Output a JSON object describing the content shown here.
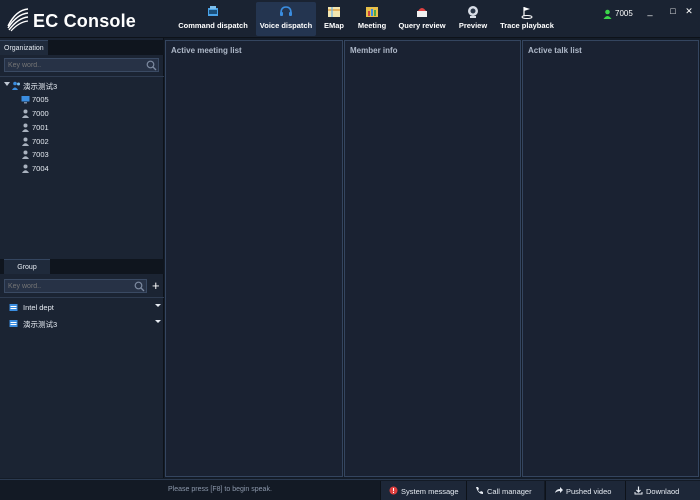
{
  "app": {
    "title": "EC Console"
  },
  "nav": [
    {
      "label": "Command dispatch",
      "icon": "command-dispatch-icon"
    },
    {
      "label": "Voice dispatch",
      "icon": "headset-icon",
      "active": true
    },
    {
      "label": "EMap",
      "icon": "map-icon"
    },
    {
      "label": "Meeting",
      "icon": "meeting-icon"
    },
    {
      "label": "Query review",
      "icon": "query-icon"
    },
    {
      "label": "Preview",
      "icon": "camera-icon"
    },
    {
      "label": "Trace playback",
      "icon": "trace-icon"
    }
  ],
  "user": {
    "name": "7005",
    "status_color": "#3cd64a"
  },
  "window_controls": {
    "minimize": "_",
    "maximize": "□",
    "close": "✕"
  },
  "organization": {
    "tab_label": "Organization",
    "search_placeholder": "Key word..",
    "root": "演示测试3",
    "members": [
      "7005",
      "7000",
      "7001",
      "7002",
      "7003",
      "7004"
    ]
  },
  "group": {
    "tab_label": "Group",
    "search_placeholder": "Key word..",
    "items": [
      "Intel dept",
      "演示测试3"
    ]
  },
  "columns": {
    "meeting_title": "Active meeting list",
    "member_title": "Member info",
    "talk_title": "Active talk list"
  },
  "statusbar": {
    "hint": "Please press [F8] to begin speak.",
    "system_message": "System message",
    "call_manager": "Call manager",
    "pushed_video": "Pushed video",
    "download": "Downlaod"
  },
  "colors": {
    "accent": "#3a8de0",
    "alert": "#e04040",
    "online": "#3cd64a"
  }
}
